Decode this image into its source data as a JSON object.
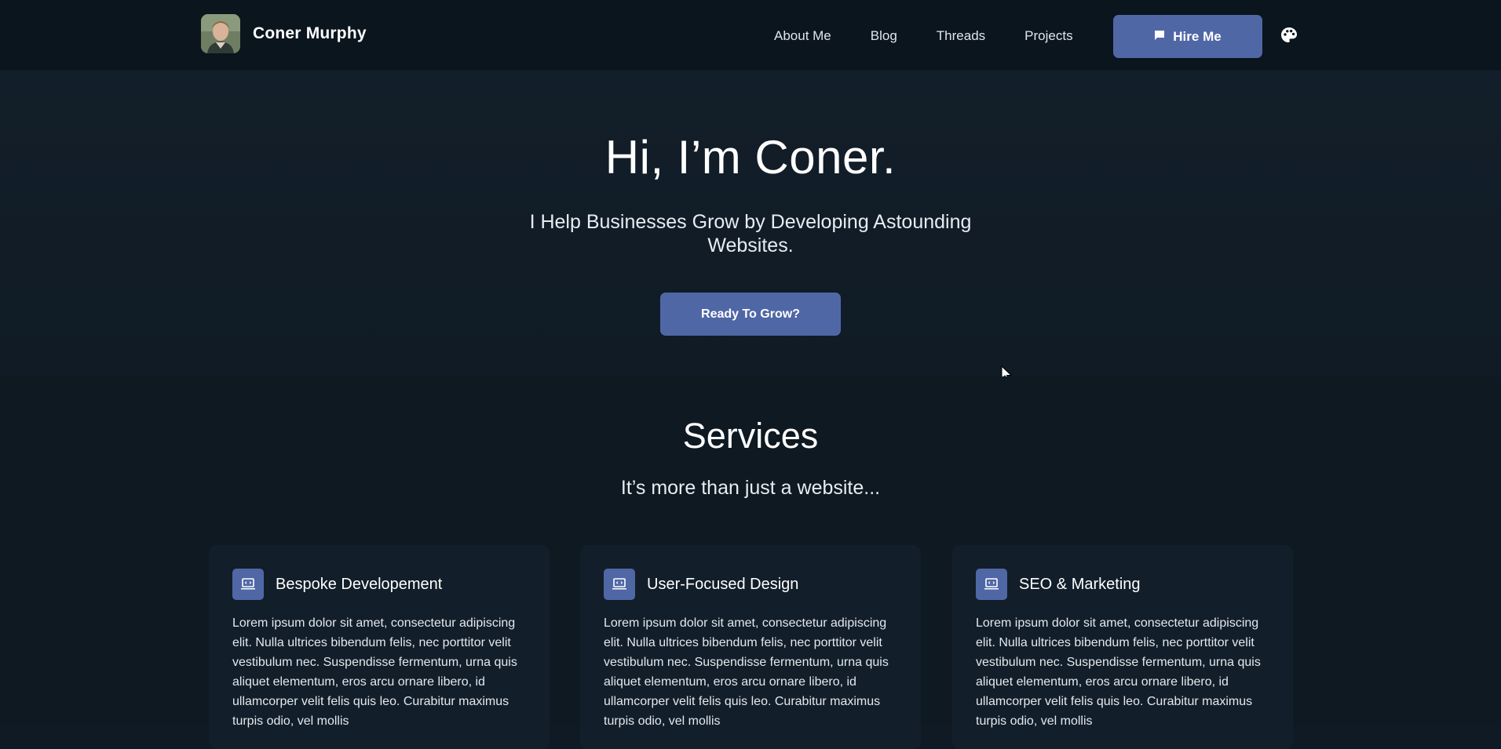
{
  "header": {
    "brand_name": "Coner Murphy",
    "nav_links": [
      "About Me",
      "Blog",
      "Threads",
      "Projects"
    ],
    "hire_label": "Hire Me",
    "hire_icon": "chat-bubble-icon",
    "theme_icon": "palette-icon"
  },
  "hero": {
    "title": "Hi, I’m Coner.",
    "subtitle": "I Help Businesses Grow by Developing Astounding Websites.",
    "cta_label": "Ready To Grow?"
  },
  "services": {
    "title": "Services",
    "subtitle": "It’s more than just a website...",
    "cards": [
      {
        "title": "Bespoke Developement",
        "icon": "laptop-code-icon",
        "text": "Lorem ipsum dolor sit amet, consectetur adipiscing elit. Nulla ultrices bibendum felis, nec porttitor velit vestibulum nec. Suspendisse fermentum, urna quis aliquet elementum, eros arcu ornare libero, id ullamcorper velit felis quis leo. Curabitur maximus turpis odio, vel mollis"
      },
      {
        "title": "User-Focused Design",
        "icon": "laptop-code-icon",
        "text": "Lorem ipsum dolor sit amet, consectetur adipiscing elit. Nulla ultrices bibendum felis, nec porttitor velit vestibulum nec. Suspendisse fermentum, urna quis aliquet elementum, eros arcu ornare libero, id ullamcorper velit felis quis leo. Curabitur maximus turpis odio, vel mollis"
      },
      {
        "title": "SEO & Marketing",
        "icon": "laptop-code-icon",
        "text": "Lorem ipsum dolor sit amet, consectetur adipiscing elit. Nulla ultrices bibendum felis, nec porttitor velit vestibulum nec. Suspendisse fermentum, urna quis aliquet elementum, eros arcu ornare libero, id ullamcorper velit felis quis leo. Curabitur maximus turpis odio, vel mollis"
      }
    ]
  },
  "colors": {
    "background": "#0f1a24",
    "navbar": "#0b151e",
    "accent": "#5067a6",
    "card": "#121e29"
  }
}
